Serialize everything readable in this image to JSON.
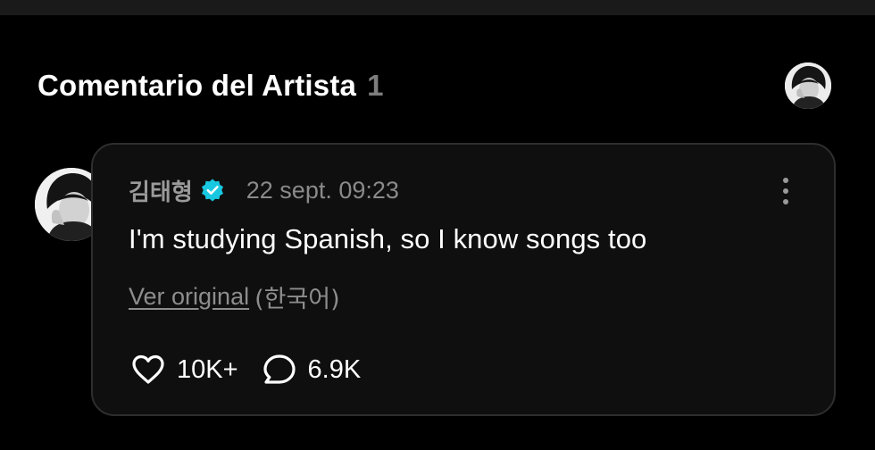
{
  "section": {
    "title": "Comentario del Artista",
    "count": "1"
  },
  "comment": {
    "author": "김태형",
    "verified": true,
    "timestamp": "22 sept. 09:23",
    "text": "I'm studying Spanish, so I know songs too",
    "translation": {
      "view_original_label": "Ver original",
      "original_language": "(한국어)"
    },
    "likes": "10K+",
    "replies": "6.9K"
  },
  "icons": {
    "verified": "verified-check-icon",
    "like": "heart-icon",
    "reply": "speech-bubble-icon",
    "more": "more-vertical-icon"
  },
  "colors": {
    "background": "#000000",
    "card_background": "#0f0f0f",
    "card_border": "#2e2e2e",
    "verified_badge": "#18c8e0",
    "muted_text": "#8a8a8a"
  }
}
